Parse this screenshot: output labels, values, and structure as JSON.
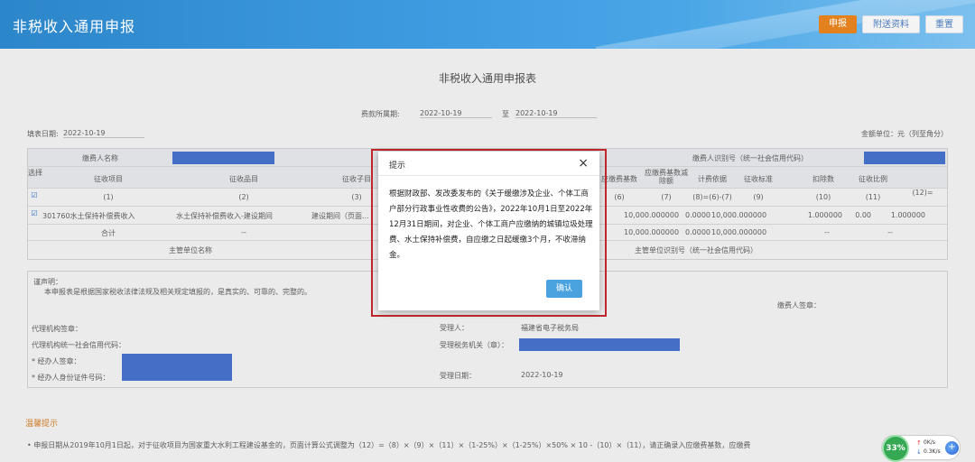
{
  "header": {
    "title": "非税收入通用申报",
    "buttons": {
      "submit": "申报",
      "attach": "附送资料",
      "reset": "重置"
    }
  },
  "form": {
    "title": "非税收入通用申报表",
    "period_label": "费款所属期:",
    "period_from": "2022-10-19",
    "period_to_label": "至",
    "period_to": "2022-10-19",
    "fill_date_label": "填表日期:",
    "fill_date": "2022-10-19",
    "unit_label": "金额单位：元（列至角分）",
    "payer_name_label": "缴费人名称",
    "payer_id_label": "缴费人识别号（统一社会信用代码）",
    "columns": [
      "选择",
      "征收项目",
      "征收品目",
      "征收子目",
      "应缴费基数",
      "应缴费基数减除额",
      "计费依据",
      "征收标准",
      "扣除数",
      "征收比例"
    ],
    "column_nums": [
      "(1)",
      "(2)",
      "(3)",
      "(6)",
      "(7)",
      "(8)=(6)-(7)",
      "(9)",
      "(10)",
      "(11)",
      "(12)="
    ],
    "row": {
      "project": "301760水土保持补偿费收入",
      "item": "水土保持补偿费收入-建设期间",
      "subitem": "建设期间（页面...",
      "base": "10,000.000000",
      "deduct_base": "0.0000",
      "basis": "10,000.000000",
      "standard": "1.000000",
      "deduct": "0.00",
      "ratio": "1.000000"
    },
    "total_label": "合计",
    "total_base": "10,000.000000",
    "total_deduct": "0.0000",
    "total_basis": "10,000.000000",
    "total_dash": "--",
    "main_unit_name_label": "主管单位名称",
    "main_unit_id_label": "主管单位识别号（统一社会信用代码）"
  },
  "declaration": {
    "heading": "谨声明：",
    "text": "本申报表是根据国家税收法律法规及相关规定填报的，是真实的、可靠的、完整的。",
    "sign_label": "缴费人签章：",
    "agent_sign_label": "代理机构签章：",
    "agent_code_label": "代理机构统一社会信用代码：",
    "handler_label": "* 经办人签章：",
    "handler_id_label": "* 经办人身份证件号码：",
    "receiver_label": "受理人：",
    "receiver_value": "福建省电子税务局",
    "receiver_org_label": "受理税务机关（章）：",
    "accept_date_label": "受理日期：",
    "accept_date": "2022-10-19"
  },
  "warning": {
    "title": "温馨提示",
    "text": "• 申报日期从2019年10月1日起，对于征收项目为国家重大水利工程建设基金的，页面计算公式调整为（12）=（8）×（9）×（11）×（1-25%）×（1-25%）×50% × 10 -（10）×（11），请正确录入应缴费基数，应缴费"
  },
  "modal": {
    "title": "提示",
    "close": "×",
    "body": "根据财政部、国家发展改革委发布的《关于缓缴涉及企业、个体工商户部分行政事业性收费的公告》，2022年10月1日至2022年12月31日期间，对企业、个体工商户应缴纳的城镇垃圾处理费、水土保持补偿费，自应缴之日起缓缴3个月，不收滞纳金。",
    "body_display": "根据财政部、发改委发布的《关于缓缴涉及企业、个体工商户部分行政事业性收费的公告》，2022年10月1日至2022年12月31日期间，对企业、个体工商户应缴纳的城镇垃圾处理费、水土保持补偿费，自应缴之日起缓缴3个月，不收滞纳金。",
    "confirm": "确认"
  },
  "speed_widget": {
    "percent": "33%",
    "up": "0K/s",
    "down": "0.3K/s",
    "up_icon": "↑",
    "down_icon": "↓",
    "plus": "+"
  },
  "colors": {
    "header": "#3f9be0",
    "submit": "#e2811e",
    "highlight": "#c0272d",
    "confirm": "#4aa3df",
    "redaction": "#4b79d8"
  }
}
